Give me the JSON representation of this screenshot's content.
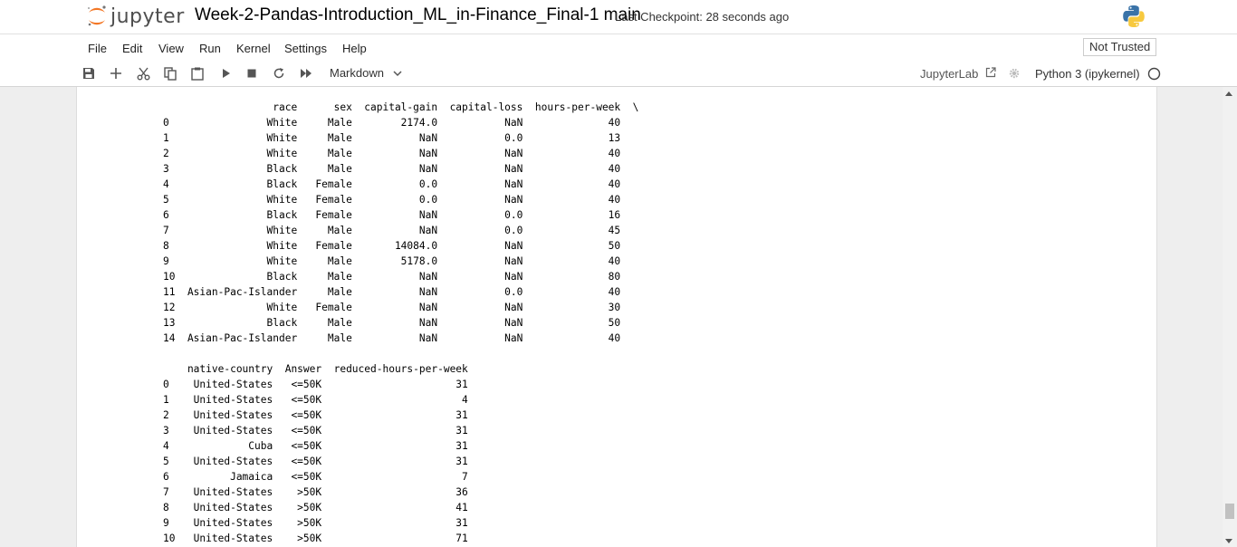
{
  "header": {
    "logo_text": "jupyter",
    "notebook_title": "Week-2-Pandas-Introduction_ML_in-Finance_Final-1 main",
    "checkpoint": "Last Checkpoint: 28 seconds ago"
  },
  "menu": {
    "items": [
      "File",
      "Edit",
      "View",
      "Run",
      "Kernel",
      "Settings",
      "Help"
    ],
    "trust_status": "Not Trusted"
  },
  "toolbar": {
    "cell_type": "Markdown",
    "jupyterlab_label": "JupyterLab",
    "kernel_name": "Python 3 (ipykernel)",
    "icons": [
      "save-icon",
      "add-cell-icon",
      "cut-icon",
      "copy-icon",
      "paste-icon",
      "run-icon",
      "stop-icon",
      "restart-icon",
      "fast-forward-icon"
    ]
  },
  "output": {
    "table1": {
      "header": "                  race      sex  capital-gain  capital-loss  hours-per-week  \\",
      "rows": [
        "0                White     Male        2174.0           NaN              40",
        "1                White     Male           NaN           0.0              13",
        "2                White     Male           NaN           NaN              40",
        "3                Black     Male           NaN           NaN              40",
        "4                Black   Female           0.0           NaN              40",
        "5                White   Female           0.0           NaN              40",
        "6                Black   Female           NaN           0.0              16",
        "7                White     Male           NaN           0.0              45",
        "8                White   Female       14084.0           NaN              50",
        "9                White     Male        5178.0           NaN              40",
        "10               Black     Male           NaN           NaN              80",
        "11  Asian-Pac-Islander     Male           NaN           0.0              40",
        "12               White   Female           NaN           NaN              30",
        "13               Black     Male           NaN           NaN              50",
        "14  Asian-Pac-Islander     Male           NaN           NaN              40"
      ]
    },
    "table2": {
      "header": "    native-country  Answer  reduced-hours-per-week",
      "rows": [
        "0    United-States   <=50K                      31",
        "1    United-States   <=50K                       4",
        "2    United-States   <=50K                      31",
        "3    United-States   <=50K                      31",
        "4             Cuba   <=50K                      31",
        "5    United-States   <=50K                      31",
        "6          Jamaica   <=50K                       7",
        "7    United-States    >50K                      36",
        "8    United-States    >50K                      41",
        "9    United-States    >50K                      31",
        "10   United-States    >50K                      71"
      ]
    }
  }
}
